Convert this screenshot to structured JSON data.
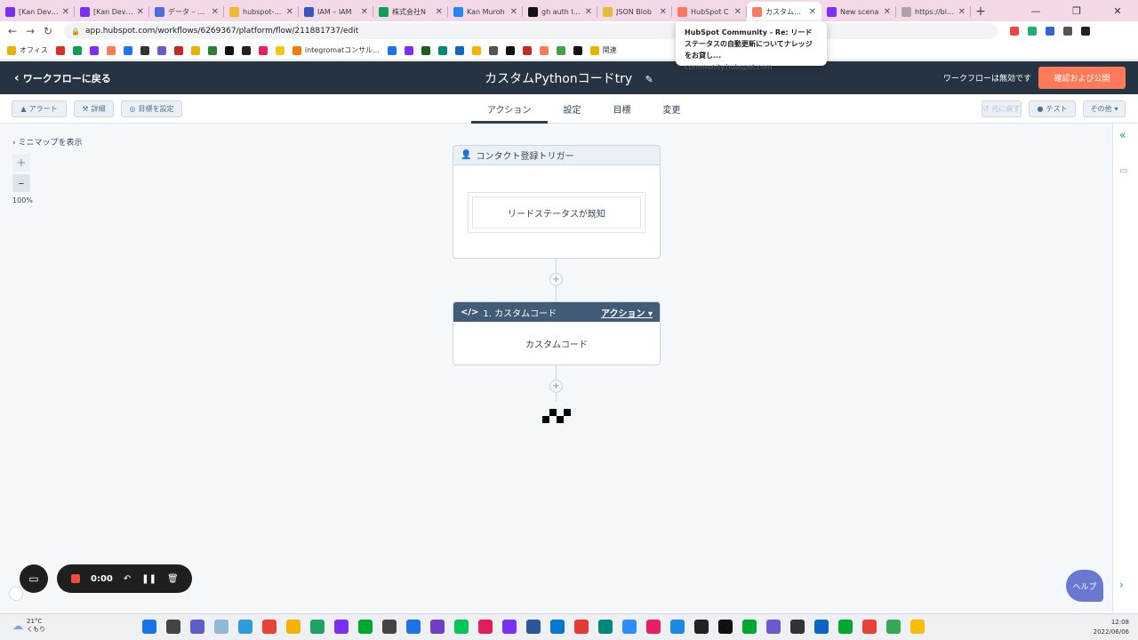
{
  "browser": {
    "tabs": [
      {
        "label": "[Kan Dev]Hu",
        "color": "#7b2ff7"
      },
      {
        "label": "[Kan Dev] H",
        "color": "#7b2ff7"
      },
      {
        "label": "データ – Fire",
        "color": "#4a6ee0"
      },
      {
        "label": "hubspot-ph",
        "color": "#f2b632"
      },
      {
        "label": "IAM – IAM",
        "color": "#3a56c5"
      },
      {
        "label": "株式会社N",
        "color": "#0f9d58"
      },
      {
        "label": "Kan Muroh",
        "color": "#2684ff"
      },
      {
        "label": "gh auth log",
        "color": "#111111"
      },
      {
        "label": "JSON Blob",
        "color": "#e5b93a"
      },
      {
        "label": "HubSpot C",
        "color": "#ff7a59"
      },
      {
        "label": "カスタムPyth",
        "color": "#ff7a59"
      },
      {
        "label": "New scena",
        "color": "#7b2ff7"
      },
      {
        "label": "https://blog",
        "color": "#b0a0a8"
      }
    ],
    "url": "app.hubspot.com/workflows/6269367/platform/flow/211881737/edit",
    "bookmarks": [
      {
        "label": "オフィス",
        "color": "#e8b100"
      },
      {
        "label": "integromatコンサル...",
        "color": "#f57c00"
      },
      {
        "label": "関連",
        "color": "#e8b100"
      }
    ],
    "tooltip": {
      "title": "HubSpot Community - Re: リードステータスの自動更新についてナレッジをお貸し...",
      "url": "community.hubspot.com"
    }
  },
  "header": {
    "back_label": "ワークフローに戻る",
    "title": "カスタムPythonコードtry",
    "status": "ワークフローは無効です",
    "publish_label": "確認および公開"
  },
  "subbar": {
    "alert_label": "アラート",
    "details_label": "詳細",
    "goal_label": "目標を設定",
    "tabs": [
      "アクション",
      "設定",
      "目標",
      "変更"
    ],
    "revert_label": "元に戻す",
    "test_label": "テスト",
    "more_label": "その他"
  },
  "canvas": {
    "minimap_label": "ミニマップを表示",
    "zoom": "100%",
    "trigger": {
      "title": "コンタクト登録トリガー",
      "filter": "リードステータスが既知"
    },
    "action": {
      "title": "1. カスタムコード",
      "link_label": "アクション",
      "body": "カスタムコード"
    }
  },
  "help_label": "ヘルプ",
  "recorder": {
    "time": "0:00"
  },
  "taskbar": {
    "temp": "21°C",
    "weather": "くもり",
    "time": "12:08",
    "date": "2022/06/06"
  },
  "colors": {
    "header_bg": "#253342",
    "publish_bg": "#ff7a59",
    "action_head": "#425b76",
    "help_bg": "#6a78d1"
  }
}
